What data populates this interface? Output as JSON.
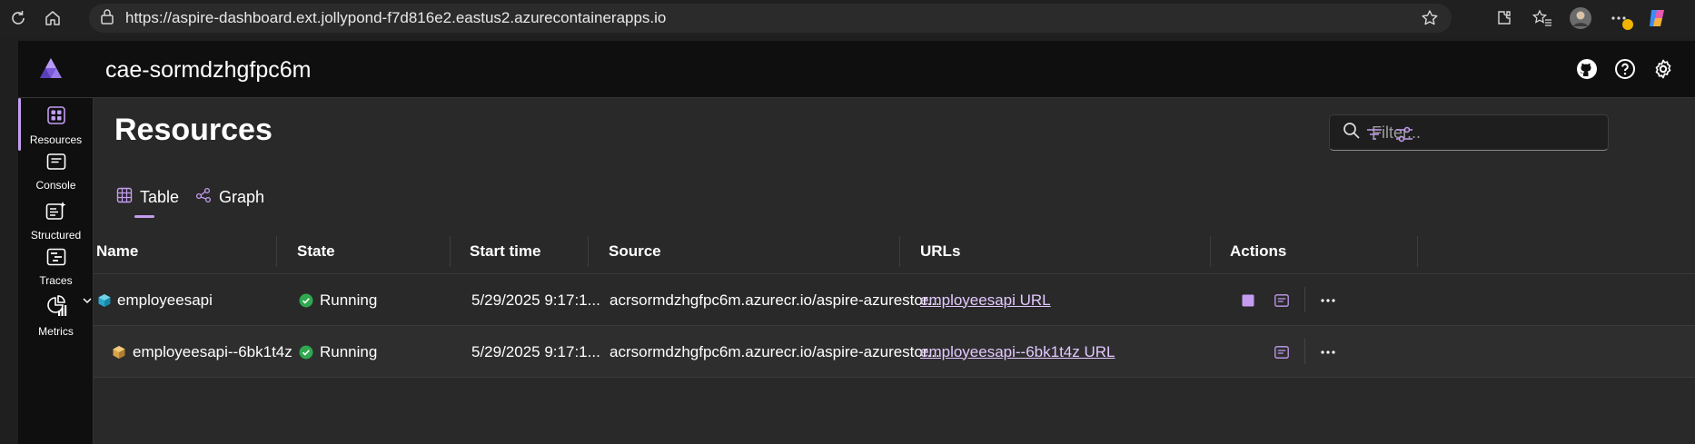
{
  "browser": {
    "url": "https://aspire-dashboard.ext.jollypond-f7d816e2.eastus2.azurecontainerapps.io"
  },
  "app": {
    "title": "cae-sormdzhgfpc6m"
  },
  "sidebar": {
    "items": [
      {
        "label": "Resources",
        "icon": "resources-icon"
      },
      {
        "label": "Console",
        "icon": "console-icon"
      },
      {
        "label": "Structured",
        "icon": "structured-icon"
      },
      {
        "label": "Traces",
        "icon": "traces-icon"
      },
      {
        "label": "Metrics",
        "icon": "metrics-icon"
      }
    ]
  },
  "page": {
    "title": "Resources",
    "filter_placeholder": "Filter...",
    "tabs": [
      {
        "label": "Table"
      },
      {
        "label": "Graph"
      }
    ]
  },
  "table": {
    "headers": [
      "Name",
      "State",
      "Start time",
      "Source",
      "URLs",
      "Actions"
    ],
    "rows": [
      {
        "name": "employeesapi",
        "state": "Running",
        "start_time": "5/29/2025 9:17:1...",
        "source": "acrsormdzhgfpc6m.azurecr.io/aspire-azurestor...",
        "url": "employeesapi URL"
      },
      {
        "name": "employeesapi--6bk1t4z",
        "state": "Running",
        "start_time": "5/29/2025 9:17:1...",
        "source": "acrsormdzhgfpc6m.azurecr.io/aspire-azurestor...",
        "url": "employeesapi--6bk1t4z URL"
      }
    ]
  },
  "colors": {
    "accent": "#c49df0",
    "running": "#2fa84f",
    "link": "#e3c8ff"
  }
}
